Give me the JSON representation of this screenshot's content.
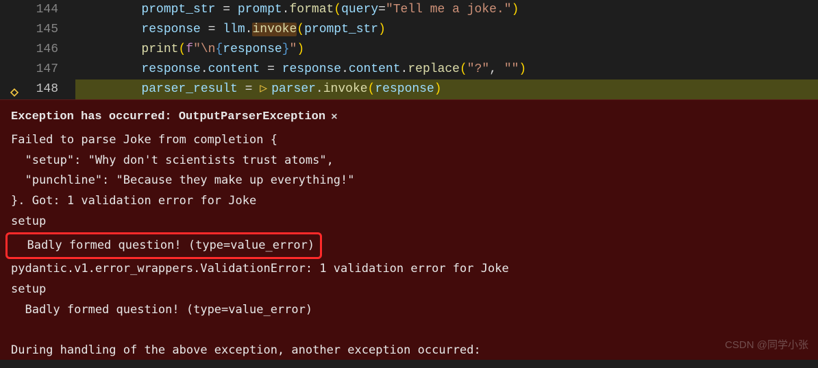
{
  "code": {
    "lines": [
      {
        "num": "144",
        "tokens": [
          {
            "t": "        ",
            "c": ""
          },
          {
            "t": "prompt_str",
            "c": "tk-var"
          },
          {
            "t": " = ",
            "c": "tk-op"
          },
          {
            "t": "prompt",
            "c": "tk-var"
          },
          {
            "t": ".",
            "c": "tk-punc"
          },
          {
            "t": "format",
            "c": "tk-func"
          },
          {
            "t": "(",
            "c": "tk-paren1"
          },
          {
            "t": "query",
            "c": "tk-param"
          },
          {
            "t": "=",
            "c": "tk-op"
          },
          {
            "t": "\"Tell me a joke.\"",
            "c": "tk-str"
          },
          {
            "t": ")",
            "c": "tk-paren1"
          }
        ]
      },
      {
        "num": "145",
        "tokens": [
          {
            "t": "        ",
            "c": ""
          },
          {
            "t": "response",
            "c": "tk-var"
          },
          {
            "t": " = ",
            "c": "tk-op"
          },
          {
            "t": "llm",
            "c": "tk-var"
          },
          {
            "t": ".",
            "c": "tk-punc"
          },
          {
            "t": "invoke",
            "c": "tk-func tk-invoke-highlight"
          },
          {
            "t": "(",
            "c": "tk-paren1"
          },
          {
            "t": "prompt_str",
            "c": "tk-var"
          },
          {
            "t": ")",
            "c": "tk-paren1"
          }
        ]
      },
      {
        "num": "146",
        "tokens": [
          {
            "t": "        ",
            "c": ""
          },
          {
            "t": "print",
            "c": "tk-func"
          },
          {
            "t": "(",
            "c": "tk-paren1"
          },
          {
            "t": "f",
            "c": "tk-fstr"
          },
          {
            "t": "\"\\n",
            "c": "tk-str"
          },
          {
            "t": "{",
            "c": "tk-brace"
          },
          {
            "t": "response",
            "c": "tk-var"
          },
          {
            "t": "}",
            "c": "tk-brace"
          },
          {
            "t": "\"",
            "c": "tk-str"
          },
          {
            "t": ")",
            "c": "tk-paren1"
          }
        ]
      },
      {
        "num": "147",
        "tokens": [
          {
            "t": "        ",
            "c": ""
          },
          {
            "t": "response",
            "c": "tk-var"
          },
          {
            "t": ".",
            "c": "tk-punc"
          },
          {
            "t": "content",
            "c": "tk-prop"
          },
          {
            "t": " = ",
            "c": "tk-op"
          },
          {
            "t": "response",
            "c": "tk-var"
          },
          {
            "t": ".",
            "c": "tk-punc"
          },
          {
            "t": "content",
            "c": "tk-prop"
          },
          {
            "t": ".",
            "c": "tk-punc"
          },
          {
            "t": "replace",
            "c": "tk-func"
          },
          {
            "t": "(",
            "c": "tk-paren1"
          },
          {
            "t": "\"?\"",
            "c": "tk-str"
          },
          {
            "t": ", ",
            "c": "tk-punc"
          },
          {
            "t": "\"\"",
            "c": "tk-str"
          },
          {
            "t": ")",
            "c": "tk-paren1"
          }
        ]
      },
      {
        "num": "148",
        "current": true,
        "breakpoint": true,
        "tokens": [
          {
            "t": "        ",
            "c": ""
          },
          {
            "t": "parser_result",
            "c": "tk-var"
          },
          {
            "t": " = ",
            "c": "tk-op"
          },
          {
            "t": "▷",
            "c": "inline-debug-icon"
          },
          {
            "t": "parser",
            "c": "tk-var"
          },
          {
            "t": ".",
            "c": "tk-punc"
          },
          {
            "t": "invoke",
            "c": "tk-func"
          },
          {
            "t": "(",
            "c": "tk-paren1"
          },
          {
            "t": "response",
            "c": "tk-var"
          },
          {
            "t": ")",
            "c": "tk-paren1"
          }
        ]
      }
    ]
  },
  "exception": {
    "header": "Exception has occurred: OutputParserException",
    "close": "×",
    "body_lines": [
      "Failed to parse Joke from completion {",
      "  \"setup\": \"Why don't scientists trust atoms\",",
      "  \"punchline\": \"Because they make up everything!\"",
      "}. Got: 1 validation error for Joke",
      "setup"
    ],
    "highlighted_line": "  Badly formed question! (type=value_error)",
    "body_lines2": [
      "pydantic.v1.error_wrappers.ValidationError: 1 validation error for Joke",
      "setup",
      "  Badly formed question! (type=value_error)",
      "",
      "During handling of the above exception, another exception occurred:"
    ]
  },
  "watermark": "CSDN @同学小张"
}
